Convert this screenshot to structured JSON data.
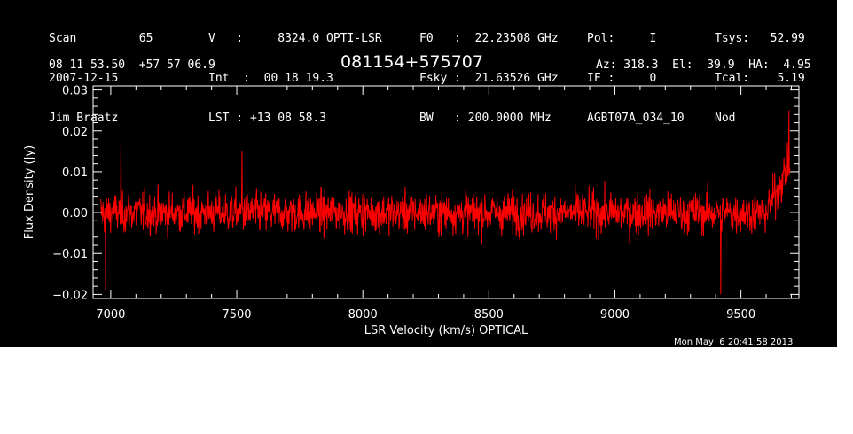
{
  "header": {
    "col1": [
      "Scan         65",
      "2007-12-15",
      "Jim Braatz"
    ],
    "col2": [
      "V   :     8324.0 OPTI-LSR",
      "Int  :  00 18 19.3",
      "LST : +13 08 58.3"
    ],
    "col3": [
      "F0   :  22.23508 GHz",
      "Fsky :  21.63526 GHz",
      "BW   : 200.0000 MHz"
    ],
    "col4": [
      "Pol:     I",
      "IF :     0",
      "AGBT07A_034_10"
    ],
    "col5": [
      "Tsys:   52.99",
      "Tcal:    5.19",
      "Nod"
    ],
    "coords": "08 11 53.50  +57 57 06.9",
    "source": "081154+575707",
    "pointing": "Az: 318.3  El:  39.9  HA:  4.95"
  },
  "timestamp": "Mon May  6 20:41:58 2013",
  "chart_data": {
    "type": "line",
    "xlabel": "LSR Velocity (km/s) OPTICAL",
    "ylabel": "Flux Density (Jy)",
    "xlim": [
      6930,
      9730
    ],
    "ylim": [
      -0.021,
      0.031
    ],
    "xticks": [
      7000,
      7500,
      8000,
      8500,
      9000,
      9500
    ],
    "xtick_labels": [
      "7000",
      "7500",
      "8000",
      "8500",
      "9000",
      "9500"
    ],
    "yticks": [
      -0.02,
      -0.01,
      0.0,
      0.01,
      0.02,
      0.03
    ],
    "ytick_labels": [
      "−0.02",
      "−0.01",
      "0.00",
      "0.01",
      "0.02",
      "0.03"
    ],
    "series": [
      {
        "color": "#ff0000",
        "x_start": 6960,
        "x_end": 9695,
        "baseline": 0.0,
        "noise_rms": 0.0045,
        "features": [
          {
            "x": 6980,
            "y": -0.019
          },
          {
            "x": 7040,
            "y": 0.017
          },
          {
            "x": 7520,
            "y": 0.015
          },
          {
            "x": 9420,
            "y": -0.02
          },
          {
            "x": 9690,
            "y": 0.025
          }
        ]
      }
    ],
    "grid": false
  },
  "colors": {
    "background": "#000000",
    "trace": "#ff0000",
    "text": "#ffffff"
  }
}
